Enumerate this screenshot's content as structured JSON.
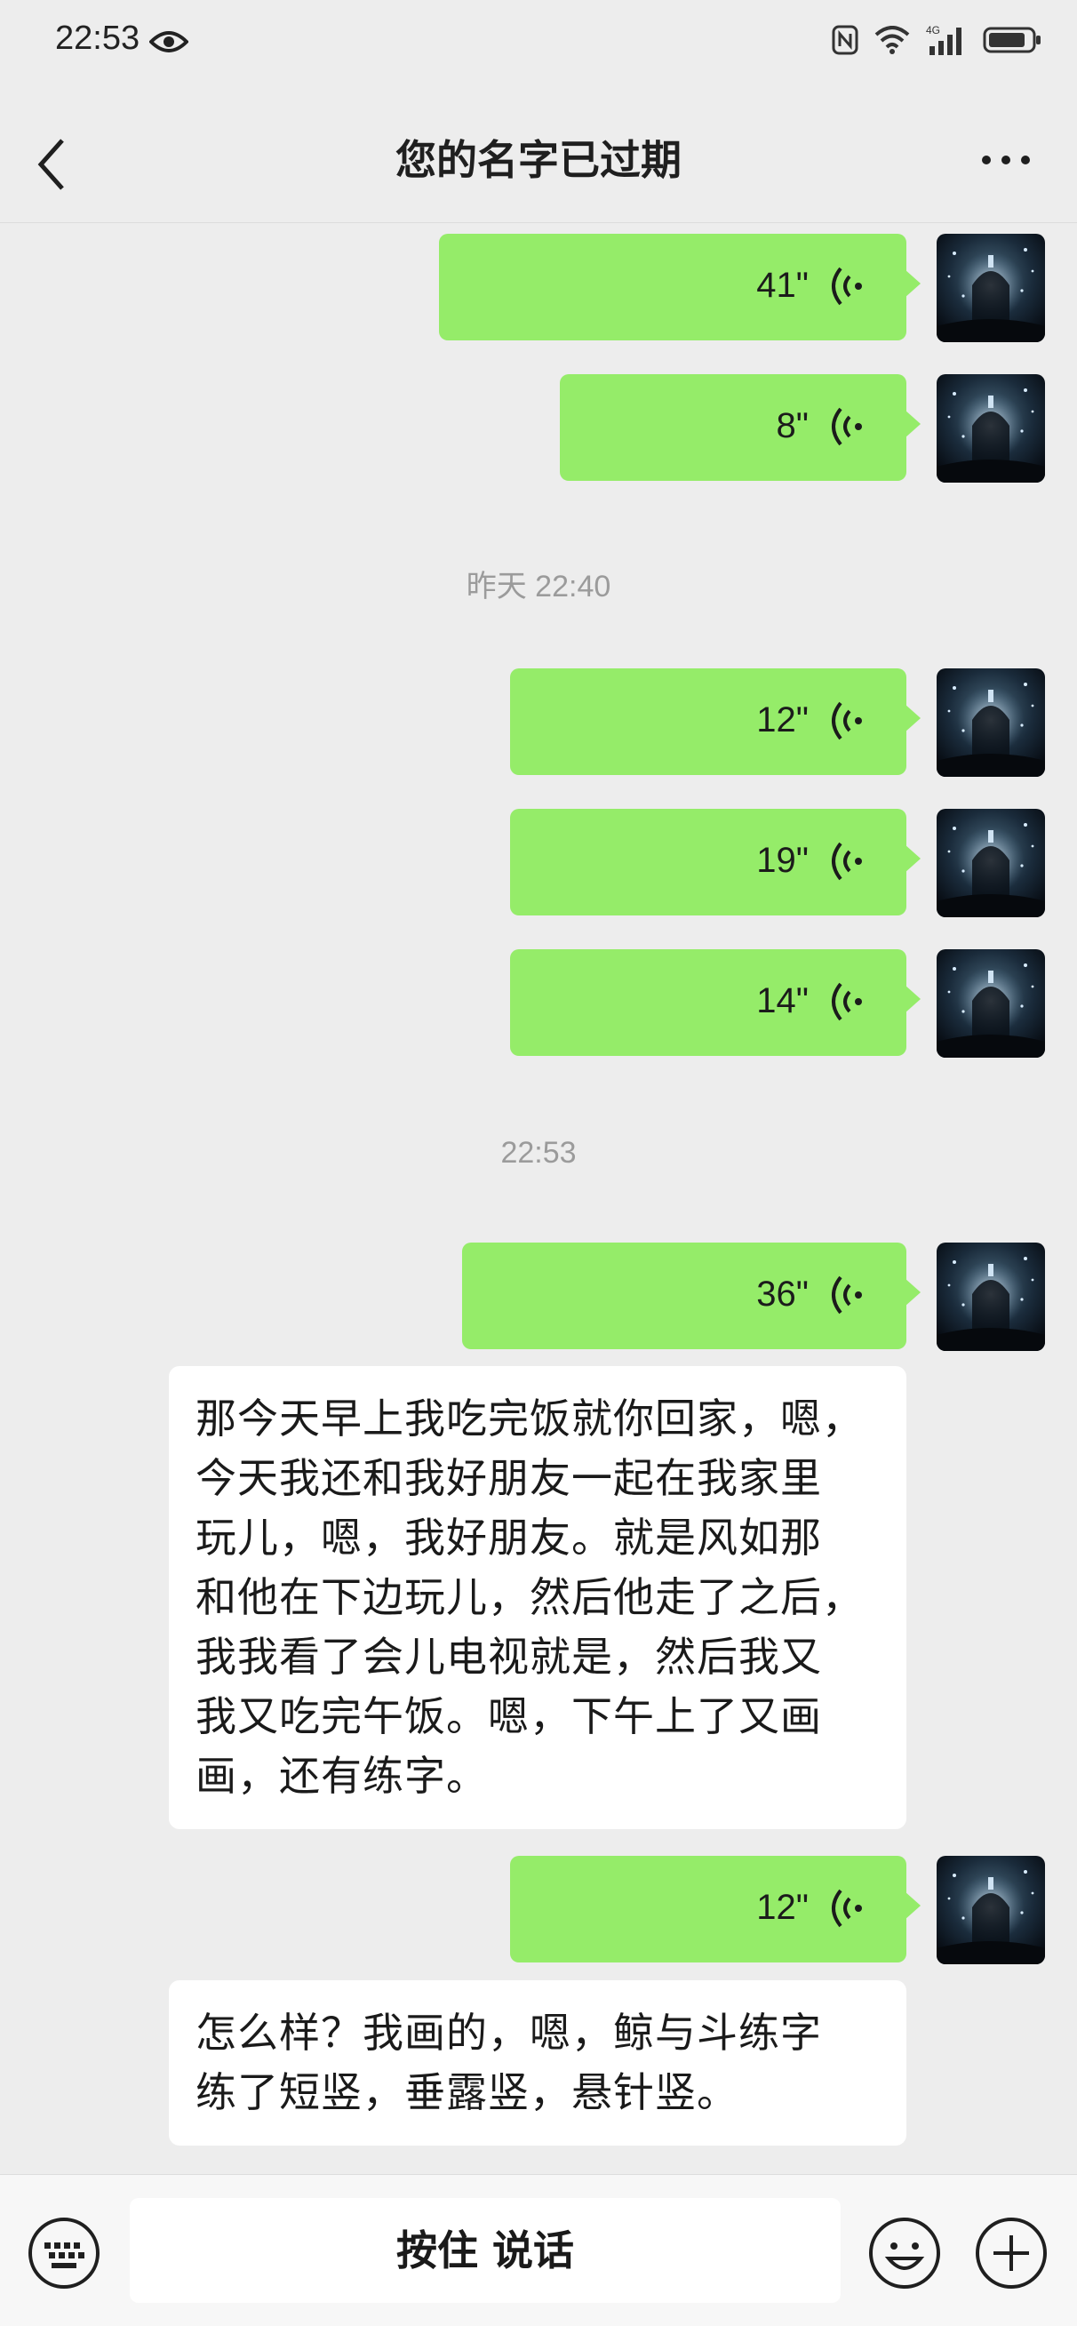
{
  "status_bar": {
    "time": "22:53",
    "network": "4G"
  },
  "header": {
    "title": "您的名字已过期"
  },
  "messages": [
    {
      "type": "voice",
      "duration": "41\""
    },
    {
      "type": "voice",
      "duration": "8\""
    },
    {
      "type": "timestamp",
      "text": "昨天 22:40"
    },
    {
      "type": "voice",
      "duration": "12\""
    },
    {
      "type": "voice",
      "duration": "19\""
    },
    {
      "type": "voice",
      "duration": "14\""
    },
    {
      "type": "timestamp",
      "text": "22:53"
    },
    {
      "type": "voice",
      "duration": "36\""
    },
    {
      "type": "transcript",
      "lines": [
        "那今天早上我吃完饭就你回家，嗯，",
        "今天我还和我好朋友一起在我家里",
        "玩儿，嗯，我好朋友。就是风如那",
        "和他在下边玩儿，然后他走了之后，",
        "我我看了会儿电视就是，然后我又",
        "我又吃完午饭。嗯，下午上了又画",
        "画，还有练字。"
      ]
    },
    {
      "type": "voice",
      "duration": "12\""
    },
    {
      "type": "transcript",
      "lines": [
        "怎么样？我画的，嗯，鲸与斗练字",
        "练了短竖，垂露竖，悬针竖。"
      ]
    }
  ],
  "input_bar": {
    "hold_to_talk_label": "按住 说话"
  },
  "colors": {
    "bubble": "#95ec69",
    "background": "#ededed"
  }
}
